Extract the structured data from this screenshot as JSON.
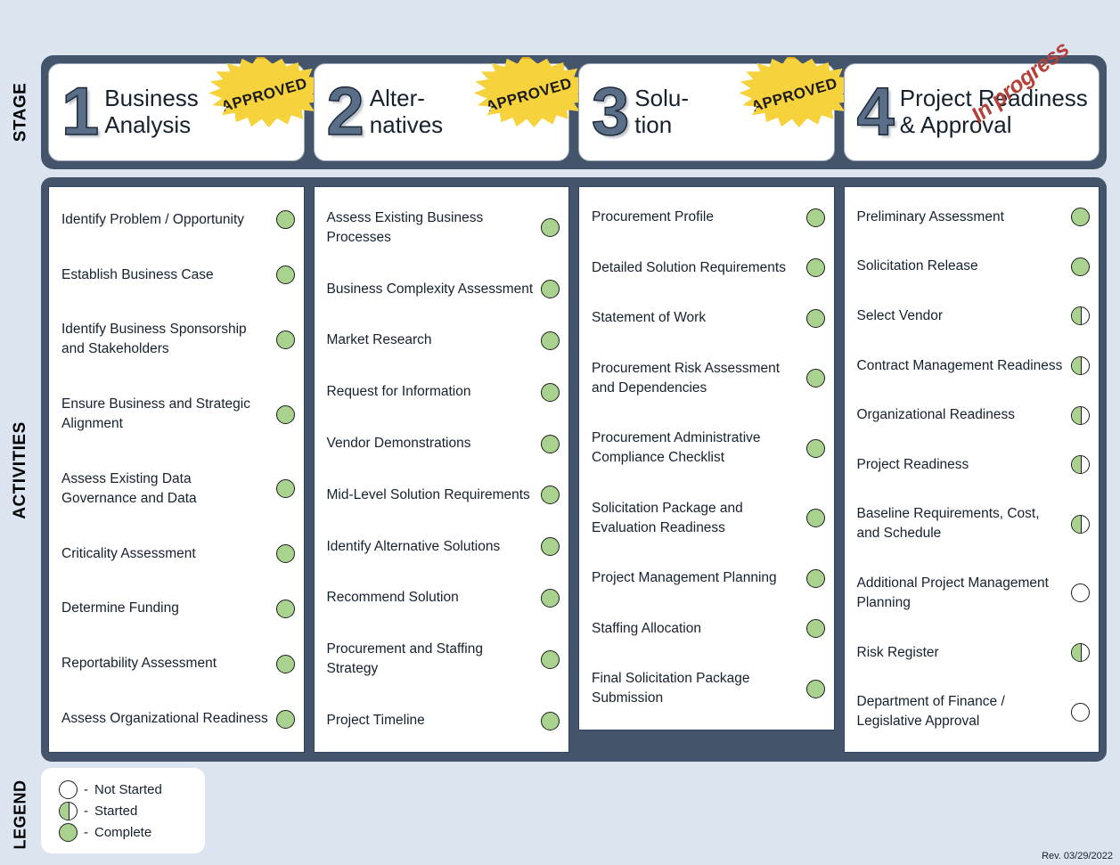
{
  "row_labels": {
    "stage": "STAGE",
    "activities": "ACTIVITIES",
    "legend": "LEGEND"
  },
  "stages": [
    {
      "number": "1",
      "title": "Business\nAnalysis",
      "stamp": "APPROVED",
      "stamp_type": "approved"
    },
    {
      "number": "2",
      "title": "Alter-\nnatives",
      "stamp": "APPROVED",
      "stamp_type": "approved"
    },
    {
      "number": "3",
      "title": "Solu-\ntion",
      "stamp": "APPROVED",
      "stamp_type": "approved"
    },
    {
      "number": "4",
      "title": "Project Readiness\n& Approval",
      "stamp": "In progress",
      "stamp_type": "in-progress"
    }
  ],
  "columns": [
    {
      "stage": "1",
      "activities": [
        {
          "label": "Identify Problem / Opportunity",
          "status": "complete"
        },
        {
          "label": "Establish Business Case",
          "status": "complete"
        },
        {
          "label": "Identify Business Sponsorship and Stakeholders",
          "status": "complete"
        },
        {
          "label": "Ensure Business and Strategic Alignment",
          "status": "complete"
        },
        {
          "label": "Assess Existing Data Governance and Data",
          "status": "complete"
        },
        {
          "label": "Criticality Assessment",
          "status": "complete"
        },
        {
          "label": "Determine Funding",
          "status": "complete"
        },
        {
          "label": "Reportability Assessment",
          "status": "complete"
        },
        {
          "label": "Assess Organizational Readiness",
          "status": "complete"
        }
      ]
    },
    {
      "stage": "2",
      "activities": [
        {
          "label": "Assess Existing Business Processes",
          "status": "complete"
        },
        {
          "label": "Business Complexity Assessment",
          "status": "complete"
        },
        {
          "label": "Market Research",
          "status": "complete"
        },
        {
          "label": "Request for Information",
          "status": "complete"
        },
        {
          "label": "Vendor Demonstrations",
          "status": "complete"
        },
        {
          "label": "Mid-Level Solution Requirements",
          "status": "complete"
        },
        {
          "label": "Identify Alternative Solutions",
          "status": "complete"
        },
        {
          "label": "Recommend Solution",
          "status": "complete"
        },
        {
          "label": "Procurement and Staffing Strategy",
          "status": "complete"
        },
        {
          "label": "Project Timeline",
          "status": "complete"
        }
      ]
    },
    {
      "stage": "3",
      "activities": [
        {
          "label": "Procurement Profile",
          "status": "complete"
        },
        {
          "label": "Detailed Solution Requirements",
          "status": "complete"
        },
        {
          "label": "Statement of Work",
          "status": "complete"
        },
        {
          "label": "Procurement Risk Assessment and Dependencies",
          "status": "complete"
        },
        {
          "label": "Procurement Administrative Compliance Checklist",
          "status": "complete"
        },
        {
          "label": "Solicitation Package and Evaluation Readiness",
          "status": "complete"
        },
        {
          "label": "Project Management Planning",
          "status": "complete"
        },
        {
          "label": "Staffing Allocation",
          "status": "complete"
        },
        {
          "label": "Final Solicitation Package Submission",
          "status": "complete"
        }
      ]
    },
    {
      "stage": "4",
      "activities": [
        {
          "label": "Preliminary Assessment",
          "status": "complete"
        },
        {
          "label": "Solicitation Release",
          "status": "complete"
        },
        {
          "label": "Select Vendor",
          "status": "started"
        },
        {
          "label": "Contract Management Readiness",
          "status": "started"
        },
        {
          "label": "Organizational Readiness",
          "status": "started"
        },
        {
          "label": "Project Readiness",
          "status": "started"
        },
        {
          "label": "Baseline Requirements, Cost, and Schedule",
          "status": "started"
        },
        {
          "label": "Additional Project Management Planning",
          "status": "not-started"
        },
        {
          "label": "Risk Register",
          "status": "started"
        },
        {
          "label": "Department of Finance / Legislative Approval",
          "status": "not-started"
        }
      ]
    }
  ],
  "legend": {
    "items": [
      {
        "status": "not-started",
        "dash": "-",
        "label": "Not Started"
      },
      {
        "status": "started",
        "dash": "-",
        "label": "Started"
      },
      {
        "status": "complete",
        "dash": "-",
        "label": "Complete"
      }
    ]
  },
  "footer": {
    "revision": "Rev. 03/29/2022"
  },
  "colors": {
    "background": "#dce4f0",
    "panel": "#44556b",
    "card": "#ffffff",
    "numeral": "#5b6e87",
    "complete_green": "#a8d28d",
    "stamp_yellow": "#f6d23c",
    "stamp_outline": "#e3a81c",
    "in_progress_red": "#b5423a",
    "column_border": "#2e4261",
    "text": "#16212e"
  }
}
